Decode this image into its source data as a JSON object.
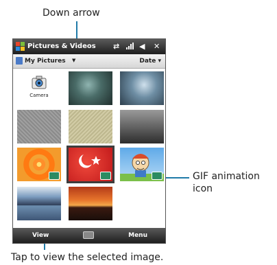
{
  "callouts": {
    "down_arrow": "Down arrow",
    "gif_icon_line1": "GIF animation",
    "gif_icon_line2": "icon",
    "tap_view": "Tap to view the selected image."
  },
  "titlebar": {
    "title": "Pictures & Videos",
    "status_icons": [
      "sync-icon",
      "signal-icon",
      "volume-icon",
      "close-icon"
    ]
  },
  "toolbar": {
    "folder_name": "My Pictures",
    "arrow_glyph": "▼",
    "sort_label": "Date ▾"
  },
  "grid": {
    "camera_label": "Camera"
  },
  "bottombar": {
    "left_softkey": "View",
    "right_softkey": "Menu"
  },
  "colors": {
    "callout_line": "#1f7aa8",
    "bar_dark": "#1e1e1e"
  }
}
